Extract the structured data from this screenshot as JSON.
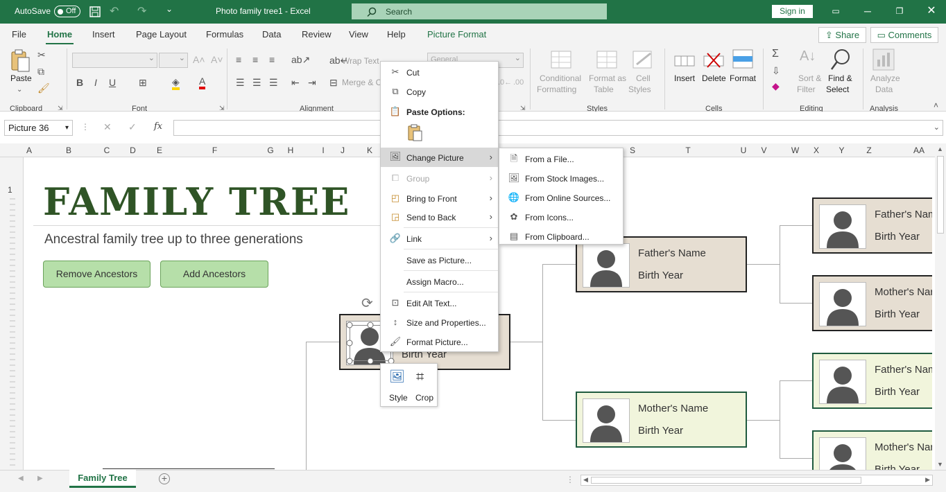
{
  "titlebar": {
    "autosave_label": "AutoSave",
    "autosave_state": "Off",
    "document_title": "Photo family tree1  -  Excel",
    "search_placeholder": "Search",
    "signin_label": "Sign in",
    "window_controls": [
      "ribbon-display-icon",
      "minimize-icon",
      "restore-icon",
      "close-icon"
    ]
  },
  "menu": {
    "tabs": [
      "File",
      "Home",
      "Insert",
      "Page Layout",
      "Formulas",
      "Data",
      "Review",
      "View",
      "Help",
      "Picture Format"
    ],
    "active_tab": "Home",
    "share_label": "Share",
    "comments_label": "Comments"
  },
  "ribbon": {
    "clipboard": {
      "group": "Clipboard",
      "paste": "Paste"
    },
    "font": {
      "group": "Font",
      "bold": "B",
      "italic": "I",
      "underline": "U"
    },
    "alignment": {
      "group": "Alignment",
      "wrap_text": "Wrap Text",
      "merge": "Merge & C"
    },
    "number": {
      "format": "General"
    },
    "styles": {
      "group": "Styles",
      "conditional": [
        "Conditional",
        "Formatting"
      ],
      "format_table": [
        "Format as",
        "Table"
      ],
      "cell_styles": [
        "Cell",
        "Styles"
      ]
    },
    "cells": {
      "group": "Cells",
      "insert": "Insert",
      "delete": "Delete",
      "format": "Format"
    },
    "editing": {
      "group": "Editing",
      "sort": [
        "Sort &",
        "Filter"
      ],
      "find": [
        "Find &",
        "Select"
      ]
    },
    "analysis": {
      "group": "Analysis",
      "analyze": [
        "Analyze",
        "Data"
      ]
    }
  },
  "formula_bar": {
    "name_box": "Picture 36",
    "fx": "fx",
    "value": ""
  },
  "columns": [
    "A",
    "B",
    "C",
    "D",
    "E",
    "F",
    "G",
    "H",
    "I",
    "J",
    "K",
    "S",
    "T",
    "U",
    "V",
    "W",
    "X",
    "Y",
    "Z",
    "AA"
  ],
  "rows": [
    "1"
  ],
  "sheet": {
    "title": "FAMILY TREE",
    "subtitle": "Ancestral family tree up to three generations",
    "remove_btn": "Remove Ancestors",
    "add_btn": "Add Ancestors",
    "root_card": {
      "year": "Birth Year"
    },
    "gen2": [
      {
        "name": "Father's Name",
        "year": "Birth Year"
      },
      {
        "name": "Mother's Name",
        "year": "Birth Year"
      }
    ],
    "gen3": [
      {
        "name": "Father's Nam",
        "year": "Birth Year"
      },
      {
        "name": "Mother's Nar",
        "year": "Birth Year"
      },
      {
        "name": "Father's Nam",
        "year": "Birth Year"
      },
      {
        "name": "Mother's Nar",
        "year": "Birth Year"
      }
    ]
  },
  "context_menu": {
    "items": [
      {
        "label": "Cut",
        "icon": "scissors-icon"
      },
      {
        "label": "Copy",
        "icon": "copy-icon"
      },
      {
        "label": "Paste Options:",
        "icon": "paste-icon"
      },
      {
        "label": "Change Picture",
        "icon": "change-picture-icon"
      },
      {
        "label": "Group",
        "icon": "group-icon"
      },
      {
        "label": "Bring to Front",
        "icon": "bring-front-icon"
      },
      {
        "label": "Send to Back",
        "icon": "send-back-icon"
      },
      {
        "label": "Link",
        "icon": "link-icon"
      },
      {
        "label": "Save as Picture...",
        "icon": ""
      },
      {
        "label": "Assign Macro...",
        "icon": ""
      },
      {
        "label": "Edit Alt Text...",
        "icon": "alt-text-icon"
      },
      {
        "label": "Size and Properties...",
        "icon": "size-icon"
      },
      {
        "label": "Format Picture...",
        "icon": "format-picture-icon"
      }
    ],
    "submenu": [
      {
        "label": "From a File..."
      },
      {
        "label": "From Stock Images..."
      },
      {
        "label": "From Online Sources..."
      },
      {
        "label": "From Icons..."
      },
      {
        "label": "From Clipboard..."
      }
    ]
  },
  "mini_toolbar": {
    "style": "Style",
    "crop": "Crop"
  },
  "sheet_tabs": {
    "active": "Family Tree"
  }
}
